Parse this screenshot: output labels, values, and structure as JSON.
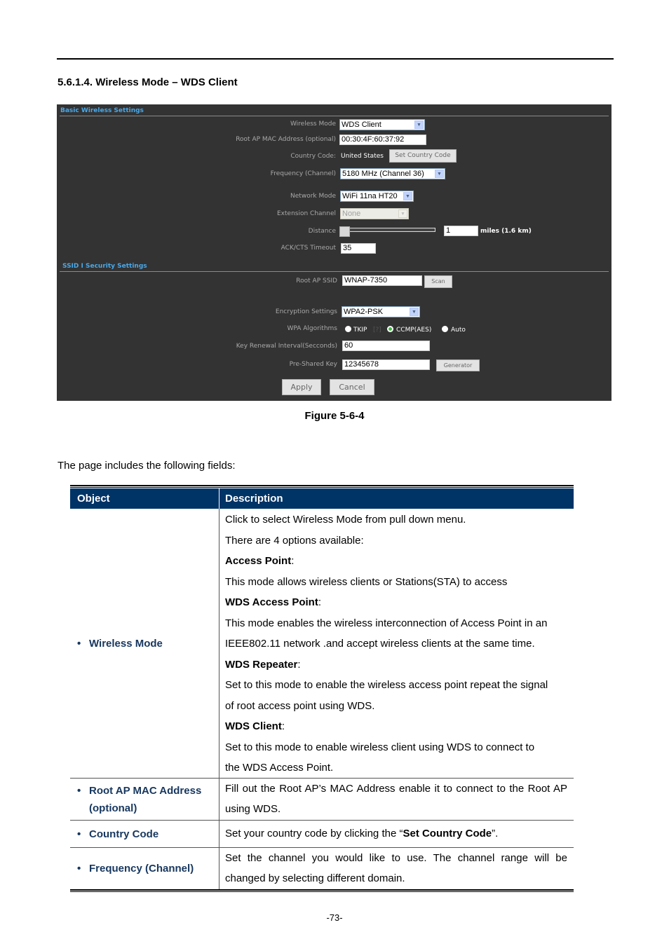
{
  "section_heading": "5.6.1.4.  Wireless Mode – WDS Client",
  "screenshot": {
    "basic_section_title": "Basic Wireless Settings",
    "security_section_title": "SSID I Security Settings",
    "fields": {
      "wireless_mode": {
        "label": "Wireless Mode",
        "value": "WDS Client"
      },
      "root_ap_mac": {
        "label": "Root AP MAC Address (optional)",
        "value": "00:30:4F:60:37:92"
      },
      "country_code": {
        "label": "Country Code:",
        "value": "United States",
        "button": "Set Country Code"
      },
      "frequency": {
        "label": "Frequency (Channel)",
        "value": "5180 MHz (Channel 36)"
      },
      "network_mode": {
        "label": "Network Mode",
        "value": "WiFi 11na HT20"
      },
      "extension_channel": {
        "label": "Extension Channel",
        "value": "None"
      },
      "distance": {
        "label": "Distance",
        "value": "1",
        "unit": "miles (1.6 km)",
        "slider_fraction": 0.0
      },
      "ack_cts_timeout": {
        "label": "ACK/CTS Timeout",
        "value": "35"
      },
      "root_ap_ssid": {
        "label": "Root AP SSID",
        "value": "WNAP-7350",
        "button": "Scan"
      },
      "encryption": {
        "label": "Encryption Settings",
        "value": "WPA2-PSK"
      },
      "wpa_algorithms": {
        "label": "WPA Algorithms",
        "options": [
          "TKIP",
          "CCMP(AES)",
          "Auto"
        ],
        "selected": "CCMP(AES)",
        "help": "[?]"
      },
      "key_renewal": {
        "label": "Key Renewal Interval(Secconds)",
        "value": "60"
      },
      "pre_shared_key": {
        "label": "Pre-Shared Key",
        "value": "12345678",
        "button": "Generator"
      }
    },
    "apply_label": "Apply",
    "cancel_label": "Cancel"
  },
  "figure_caption": "Figure 5-6-4",
  "intro_text": "The page includes the following fields:",
  "table": {
    "headers": [
      "Object",
      "Description"
    ],
    "rows": [
      {
        "object": "Wireless Mode",
        "description": [
          {
            "text": "Click to select Wireless Mode from pull down menu."
          },
          {
            "text": "There are 4 options available:"
          },
          {
            "bold": "Access Point",
            "text": ":"
          },
          {
            "text": "This mode allows wireless clients or Stations(STA) to access"
          },
          {
            "bold": "WDS Access Point",
            "text": ":"
          },
          {
            "text": "This mode enables the wireless interconnection of Access Point in an"
          },
          {
            "text": "IEEE802.11 network .and accept wireless clients at the same time."
          },
          {
            "bold": "WDS Repeater",
            "text": ":"
          },
          {
            "text": "Set to this mode to enable the wireless access point repeat the signal"
          },
          {
            "text": "of root access point using WDS."
          },
          {
            "bold": "WDS Client",
            "text": ":"
          },
          {
            "text": "Set to this mode to enable wireless client using WDS to connect to"
          },
          {
            "text": "the WDS Access Point."
          }
        ]
      },
      {
        "object_line1": "Root AP MAC Address",
        "object_line2": "(optional)",
        "description": "Fill out the Root AP’s MAC Address enable it to connect to the Root AP using WDS."
      },
      {
        "object": "Country Code",
        "description_pre": "Set your country code by clicking the “",
        "description_bold": "Set Country Code",
        "description_post": "”."
      },
      {
        "object": "Frequency (Channel)",
        "description": "Set the channel you would like to use. The channel range will be changed by selecting different domain."
      }
    ]
  },
  "page_number": "-73-"
}
